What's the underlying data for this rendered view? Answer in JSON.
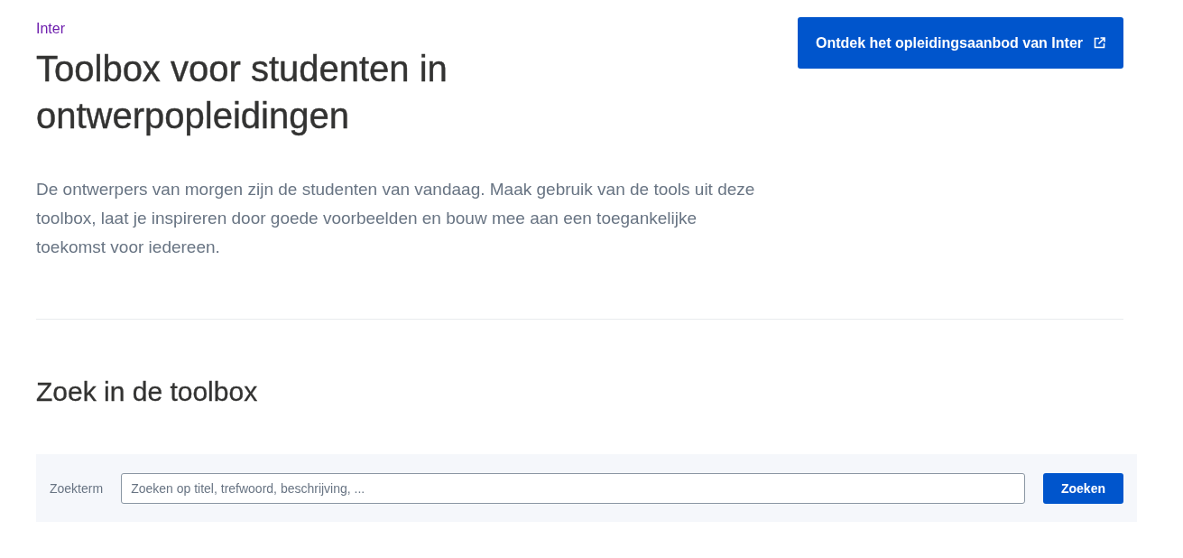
{
  "header": {
    "organisation_link": "Inter",
    "title": "Toolbox voor studenten in ontwerpopleidingen",
    "intro": "De ontwerpers van morgen zijn de studenten van vandaag. Maak gebruik van de tools uit deze toolbox, laat je inspireren door goede voorbeelden en bouw mee aan een toegankelijke toekomst voor iedereen.",
    "cta_button": "Ontdek het opleidingsaanbod van Inter"
  },
  "search": {
    "heading": "Zoek in de toolbox",
    "label": "Zoekterm",
    "placeholder": "Zoeken op titel, trefwoord, beschrijving, ...",
    "button": "Zoeken"
  }
}
